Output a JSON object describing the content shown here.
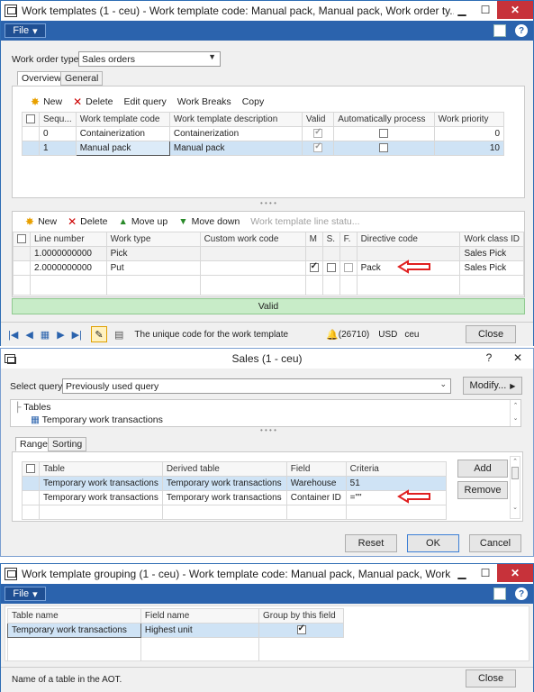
{
  "w1": {
    "title": "Work templates (1 - ceu) - Work template code: Manual pack, Manual pack, Work order ty...",
    "file_label": "File",
    "work_order_type_label": "Work order type:",
    "work_order_type_value": "Sales orders",
    "tabs": [
      "Overview",
      "General"
    ],
    "toolbar1": [
      "New",
      "Delete",
      "Edit query",
      "Work Breaks",
      "Copy"
    ],
    "grid1": {
      "headers": [
        "Sequ...",
        "Work template code",
        "Work template description",
        "Valid",
        "Automatically process",
        "Work priority"
      ],
      "rows": [
        {
          "seq": "0",
          "code": "Containerization",
          "desc": "Containerization",
          "valid": true,
          "auto": false,
          "priority": "0"
        },
        {
          "seq": "1",
          "code": "Manual pack",
          "desc": "Manual pack",
          "valid": true,
          "auto": false,
          "priority": "10"
        }
      ]
    },
    "toolbar2": [
      "New",
      "Delete",
      "Move up",
      "Move down",
      "Work template line statu..."
    ],
    "grid2": {
      "headers": [
        "Line number",
        "Work type",
        "Custom work code",
        "M",
        "S.",
        "F.",
        "Directive code",
        "Work class ID"
      ],
      "rows": [
        {
          "line": "1.0000000000",
          "type": "Pick",
          "custom": "",
          "m": false,
          "s": false,
          "f": false,
          "directive": "",
          "cls": "Sales Pick"
        },
        {
          "line": "2.0000000000",
          "type": "Put",
          "custom": "",
          "m": true,
          "s": false,
          "f": false,
          "directive": "Pack",
          "cls": "Sales Pick"
        }
      ]
    },
    "valid_text": "Valid",
    "status_text": "The unique code for the work template",
    "status_count": "(26710)",
    "currency": "USD",
    "company": "ceu",
    "close_label": "Close"
  },
  "w2": {
    "title": "Sales (1 - ceu)",
    "select_query_label": "Select query:",
    "select_query_value": "Previously used query",
    "modify_label": "Modify...",
    "tree_root": "Tables",
    "tree_child": "Temporary work transactions",
    "tabs": [
      "Range",
      "Sorting"
    ],
    "grid": {
      "headers": [
        "Table",
        "Derived table",
        "Field",
        "Criteria"
      ],
      "rows": [
        {
          "table": "Temporary work transactions",
          "derived": "Temporary work transactions",
          "field": "Warehouse",
          "criteria": "51"
        },
        {
          "table": "Temporary work transactions",
          "derived": "Temporary work transactions",
          "field": "Container ID",
          "criteria": "=\"\""
        }
      ]
    },
    "add_label": "Add",
    "remove_label": "Remove",
    "reset_label": "Reset",
    "ok_label": "OK",
    "cancel_label": "Cancel"
  },
  "w3": {
    "title": "Work template grouping (1 - ceu) - Work template code: Manual pack, Manual pack, Work ...",
    "file_label": "File",
    "grid": {
      "headers": [
        "Table name",
        "Field name",
        "Group by this field"
      ],
      "rows": [
        {
          "table": "Temporary work transactions",
          "field": "Highest unit",
          "group": true
        }
      ]
    },
    "status_text": "Name of a table in the AOT.",
    "close_label": "Close"
  },
  "colors": {
    "accent": "#2b63ad",
    "valid_bar": "#c8ecc8",
    "selection": "#cfe3f5",
    "arrow": "#e02020"
  }
}
